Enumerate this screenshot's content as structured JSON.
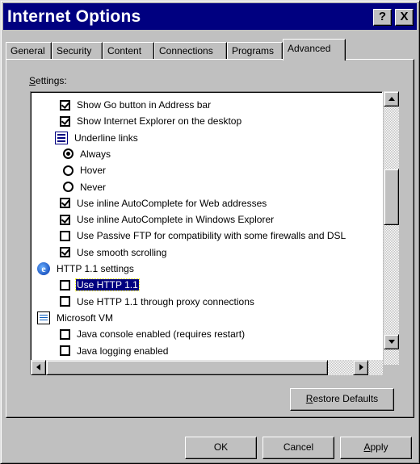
{
  "window": {
    "title": "Internet Options",
    "help_button": "?",
    "close_button": "X"
  },
  "tabs": [
    {
      "label": "General",
      "active": false
    },
    {
      "label": "Security",
      "active": false
    },
    {
      "label": "Content",
      "active": false
    },
    {
      "label": "Connections",
      "active": false
    },
    {
      "label": "Programs",
      "active": false
    },
    {
      "label": "Advanced",
      "active": true
    }
  ],
  "settings": {
    "label_accel": "S",
    "label_rest": "ettings:",
    "items": [
      {
        "kind": "checkbox",
        "checked": true,
        "label": "Show Go button in Address bar"
      },
      {
        "kind": "checkbox",
        "checked": true,
        "label": "Show Internet Explorer on the desktop"
      },
      {
        "kind": "group",
        "icon": "underline-links-icon",
        "label": "Underline links"
      },
      {
        "kind": "radio",
        "checked": true,
        "label": "Always"
      },
      {
        "kind": "radio",
        "checked": false,
        "label": "Hover"
      },
      {
        "kind": "radio",
        "checked": false,
        "label": "Never"
      },
      {
        "kind": "checkbox",
        "checked": true,
        "label": "Use inline AutoComplete for Web addresses"
      },
      {
        "kind": "checkbox",
        "checked": true,
        "label": "Use inline AutoComplete in Windows Explorer"
      },
      {
        "kind": "checkbox",
        "checked": false,
        "label": "Use Passive FTP for compatibility with some firewalls and DSL"
      },
      {
        "kind": "checkbox",
        "checked": true,
        "label": "Use smooth scrolling"
      },
      {
        "kind": "group",
        "icon": "internet-explorer-icon",
        "label": "HTTP 1.1 settings"
      },
      {
        "kind": "checkbox",
        "checked": false,
        "label": "Use HTTP 1.1",
        "selected": true
      },
      {
        "kind": "checkbox",
        "checked": false,
        "label": "Use HTTP 1.1 through proxy connections"
      },
      {
        "kind": "group",
        "icon": "microsoft-vm-icon",
        "label": "Microsoft VM"
      },
      {
        "kind": "checkbox",
        "checked": false,
        "label": "Java console enabled (requires restart)"
      },
      {
        "kind": "checkbox",
        "checked": false,
        "label": "Java logging enabled"
      }
    ]
  },
  "buttons": {
    "restore_accel": "R",
    "restore_rest": "estore Defaults",
    "ok": "OK",
    "cancel": "Cancel",
    "apply_accel": "A",
    "apply_rest": "pply"
  }
}
